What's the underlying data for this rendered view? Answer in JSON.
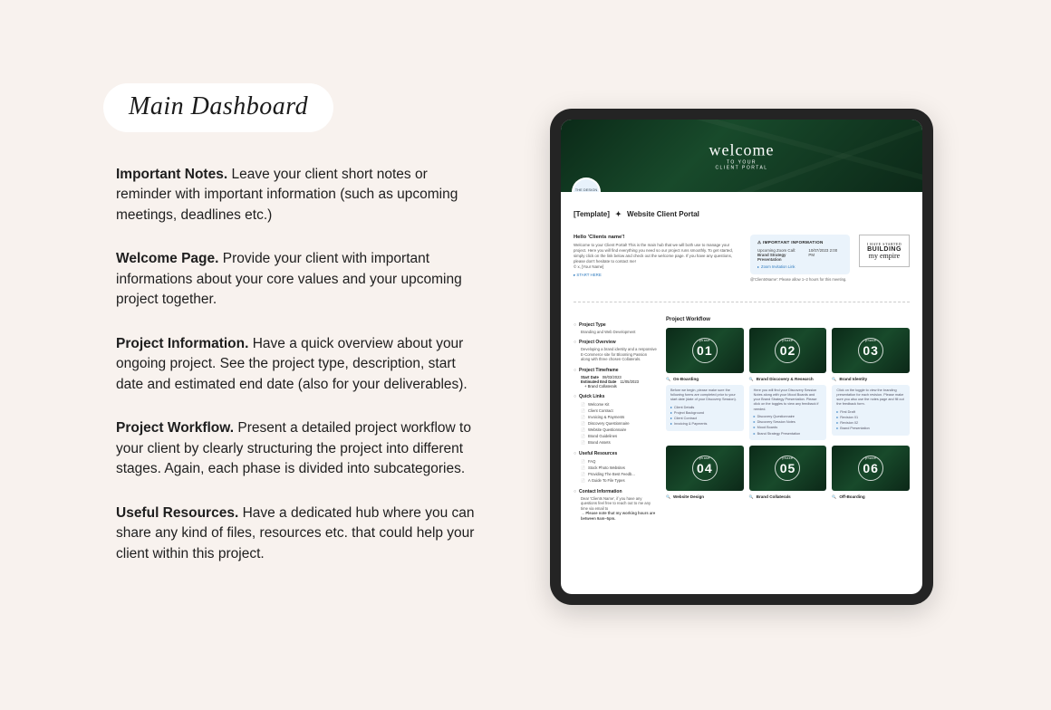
{
  "title": "Main Dashboard",
  "sections": {
    "important_notes": {
      "heading": "Important Notes.",
      "body": "Leave your client short notes or reminder with important information (such as upcoming meetings, deadlines etc.)"
    },
    "welcome_page": {
      "heading": "Welcome Page.",
      "body": "Provide your client with important informations about your core values and your upcoming project together."
    },
    "project_info": {
      "heading": "Project Information.",
      "body": "Have a quick overview about your ongoing project. See the project type, description, start date and estimated end date (also for your deliverables)."
    },
    "project_workflow": {
      "heading": "Project Workflow.",
      "body": "Present a detailed project workflow to your client by clearly structuring the project into different stages. Again, each phase is divided into subcategories."
    },
    "useful_resources": {
      "heading": "Useful Resources.",
      "body": "Have a dedicated hub where you can share any kind of files, resources etc. that could help your client within this project."
    }
  },
  "portal": {
    "hero_script": "welcome",
    "hero_sub1": "TO YOUR",
    "hero_sub2": "CLIENT PORTAL",
    "badge": "THE DESIGN STUDIO",
    "page_title_prefix": "[Template]",
    "page_title": "Website Client Portal",
    "hello": "Hello 'Clients name'!",
    "intro": "Welcome to your Client Portal! This is the main hub that we will both use to manage your project. Here you will find everything you need so our project runs smoothly. To get started, simply click on the link below and check out the welcome page. If you have any questions, please don't hesitate to contact me!",
    "intro_sign": "© x, [Your Name]",
    "start_here": "▸ START HERE",
    "important_card": {
      "header": "IMPORTANT INFORMATION",
      "line1": "Upcoming Zoom Call:",
      "line2": "Brand Strategy Presentation",
      "date": "10/07/2023 2:00 PM",
      "link": "Zoom Invitation Link"
    },
    "disclaimer": "@'ClientsName': Please allow 1–2 hours for this meeting.",
    "building_top": "I HAVE STARTED",
    "building_main": "BUILDING",
    "building_sub": "my empire",
    "sidebar": {
      "project_type_h": "Project Type",
      "project_type_v": "Branding and Web Development",
      "overview_h": "Project Overview",
      "overview_v": "Developing a brand identity and a responsive E-Commerce site for Blooming Passion along with three chosen Collaterals.",
      "timeframe_h": "Project Timeframe",
      "start_label": "Start Date",
      "start_val": "08/03/2023",
      "end_label": "Estimated End Date",
      "end_val": "11/05/2023",
      "deliv_label": "+ Brand Collaterals",
      "quicklinks_h": "Quick Links",
      "quicklinks": [
        "Welcome Kit",
        "Client Contract",
        "Invoicing & Payments",
        "Discovery Questionnaire",
        "Website Questionnaire",
        "Brand Guidelines",
        "Brand Assets"
      ],
      "resources_h": "Useful Resources",
      "resources": [
        "FAQ",
        "Stock Photo Websites",
        "Providing The Best Feedb...",
        "A Guide To File Types"
      ],
      "contact_h": "Contact Information",
      "contact_v": "Dear 'Clients Name', if you have any questions feel free to reach out to me any time via email to",
      "contact_note": "→ Please note that my working hours are between 9am–5pm."
    },
    "workflow_h": "Project Workflow",
    "phases": [
      {
        "num": "01",
        "label": "On-Boarding",
        "desc": "Before we begin, please make sure the following forms are completed prior to your start date (date of your Discovery Session).",
        "items": [
          "Client Details",
          "Project Background",
          "Client Contract",
          "Invoicing & Payments"
        ]
      },
      {
        "num": "02",
        "label": "Brand Discovery & Research",
        "desc": "Here you will find your Discovery Session Notes along with your Mood Boards and your Brand Strategy Presentation. Please click on the toggles to view any feedback if needed.",
        "items": [
          "Discovery Questionnaire",
          "Discovery Session Notes",
          "Mood Boards",
          "Brand Strategy Presentation"
        ]
      },
      {
        "num": "03",
        "label": "Brand Identity",
        "desc": "Click on the toggle to view the branding presentation for each revision. Please make sure you also use the notes page and fill out the feedback form.",
        "items": [
          "First Draft",
          "Revision 01",
          "Revision 02",
          "Brand Presentation"
        ]
      },
      {
        "num": "04",
        "label": "Website Design"
      },
      {
        "num": "05",
        "label": "Brand Collaterals"
      },
      {
        "num": "06",
        "label": "Off-Boarding"
      }
    ]
  }
}
